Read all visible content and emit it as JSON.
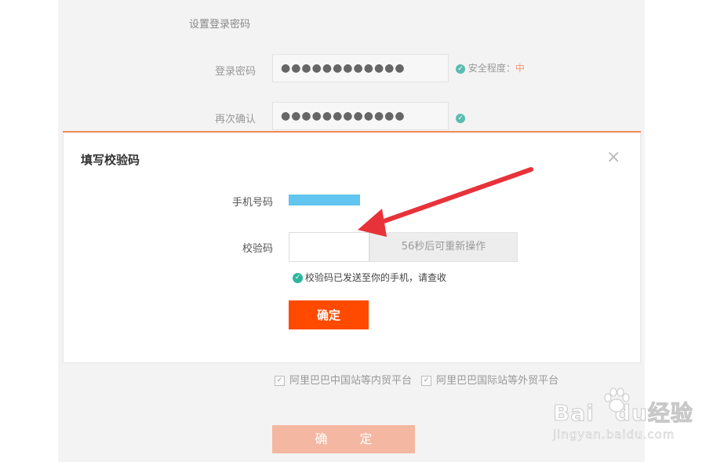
{
  "form": {
    "section_title": "设置登录密码",
    "password_label": "登录密码",
    "password_value": "●●●●●●●●●●●●",
    "confirm_label": "再次确认",
    "confirm_value": "●●●●●●●●●●●●",
    "strength_label": "安全程度：",
    "strength_level": "中"
  },
  "modal": {
    "title": "填写校验码",
    "close_icon": "×",
    "phone_label": "手机号码",
    "code_label": "校验码",
    "code_value": "",
    "resend_label": "56秒后可重新操作",
    "sent_message": "校验码已发送至你的手机，请查收",
    "confirm_label": "确定"
  },
  "agreements": [
    {
      "label": "阿里巴巴中国站等内贸平台",
      "checked": true
    },
    {
      "label": "阿里巴巴国际站等外贸平台",
      "checked": true
    }
  ],
  "submit_label": "确 定",
  "watermark": {
    "brand": "Bai经验",
    "brand_left": "Bai",
    "brand_mid": "du",
    "brand_right": "经验",
    "sub": "jingyan.baidu.com"
  },
  "colors": {
    "accent": "#ff4a00",
    "arrow": "#e8323a",
    "check": "#2fb69f",
    "phone_mask": "#61c5ef"
  }
}
